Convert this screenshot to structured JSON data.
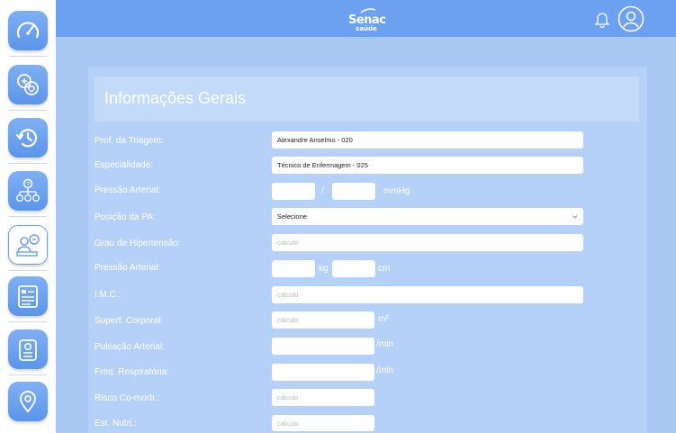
{
  "app": {
    "logo_main": "Senac",
    "logo_sub": "saúde"
  },
  "sidebar": {
    "items": [
      {
        "icon": "speedometer-icon"
      },
      {
        "icon": "health-chat-icon"
      },
      {
        "icon": "history-icon"
      },
      {
        "icon": "hierarchy-question-icon"
      },
      {
        "icon": "attendant-icon"
      },
      {
        "icon": "records-icon"
      },
      {
        "icon": "id-badge-icon"
      },
      {
        "icon": "location-pin-icon"
      }
    ]
  },
  "header": {
    "notification_icon": "bell-icon",
    "profile_icon": "user-avatar-icon"
  },
  "form": {
    "title": "Informações Gerais",
    "prof_triagem": {
      "label": "Prof. da Triagem:",
      "value": "Alexandre Anselmo - 020"
    },
    "especialidade": {
      "label": "Especialidade:",
      "value": "Técnico de Enfermagem - 025"
    },
    "pressao": {
      "label": "Pressão Arterial:",
      "separator": "/",
      "unit": "mmHg"
    },
    "posicao_pa": {
      "label": "Posição da PA:",
      "value": "Selecione"
    },
    "grau_hipertensao": {
      "label": "Grau de Hipertensão:",
      "placeholder": "cálculo"
    },
    "peso_altura": {
      "label": "Pressão Arterial:",
      "unit1": "kg",
      "unit2": "cm"
    },
    "imc": {
      "label": "I.M.C.:",
      "placeholder": "cálculo"
    },
    "superf_corporal": {
      "label": "Superf. Corporal:",
      "placeholder": "cálculo",
      "unit": "m²"
    },
    "pulsacao": {
      "label": "Pulsação Arterial:",
      "unit": "/min"
    },
    "freq_resp": {
      "label": "Freq. Respiratória:",
      "unit": "/min"
    },
    "risco": {
      "label": "Risco Co-morb.:",
      "placeholder": "cálculo"
    },
    "est_nutri": {
      "label": "Est. Nutri.:",
      "placeholder": "cálculo"
    }
  },
  "colors": {
    "topbar": "#6ba1f0",
    "background": "#a9c7f3",
    "panel": "#b6d1f7",
    "sidebar_button": "#6a9fef"
  }
}
